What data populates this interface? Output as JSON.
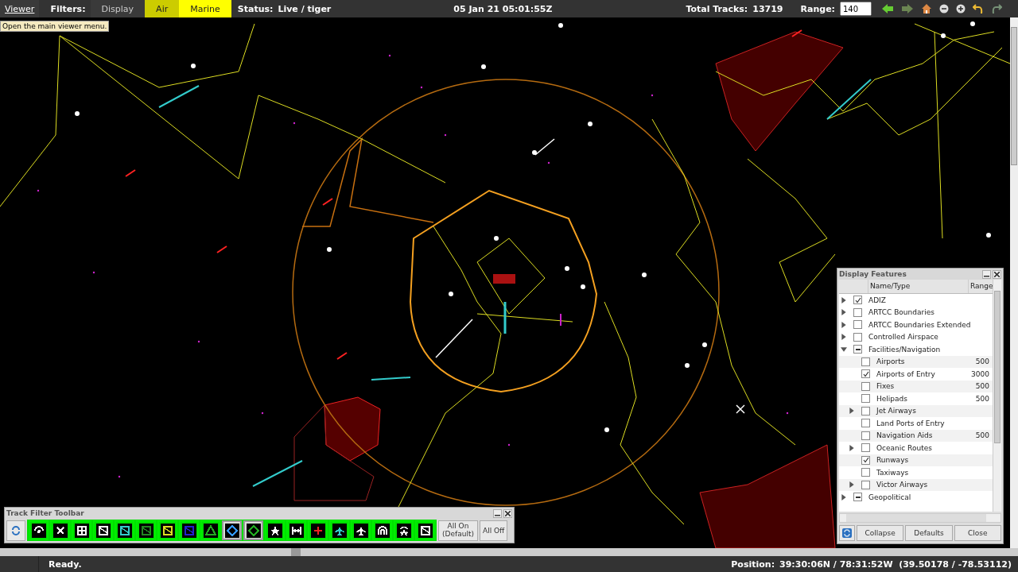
{
  "menu": {
    "label": "Viewer",
    "tooltip": "Open the main viewer menu."
  },
  "filters": {
    "label": "Filters:",
    "buttons": [
      {
        "label": "Display",
        "on": false,
        "pressed": false
      },
      {
        "label": "Air",
        "on": true,
        "pressed": true
      },
      {
        "label": "Marine",
        "on": true,
        "pressed": false
      }
    ]
  },
  "status": {
    "label": "Status:",
    "value": "Live / tiger"
  },
  "time": "05 Jan 21 05:01:55Z",
  "total_tracks": {
    "label": "Total Tracks:",
    "value": "13719"
  },
  "range": {
    "label": "Range:",
    "value": "140"
  },
  "nav_buttons": [
    {
      "kind": "back",
      "disabled": false
    },
    {
      "kind": "forward",
      "disabled": true
    },
    {
      "kind": "home",
      "disabled": false
    },
    {
      "kind": "zoom-out",
      "disabled": false
    },
    {
      "kind": "zoom-in",
      "disabled": false
    },
    {
      "kind": "undo",
      "disabled": false
    },
    {
      "kind": "redo",
      "disabled": true
    }
  ],
  "display_features": {
    "title": "Display Features",
    "columns": [
      "Name/Type",
      "Range"
    ],
    "rows": [
      {
        "label": "ADIZ",
        "checked": true,
        "partial": false,
        "expanded": false
      },
      {
        "label": "ARTCC Boundaries",
        "checked": false,
        "partial": false,
        "expanded": false
      },
      {
        "label": "ARTCC Boundaries Extended",
        "checked": false,
        "partial": false,
        "expanded": false
      },
      {
        "label": "Controlled Airspace",
        "checked": false,
        "partial": false,
        "expanded": false
      },
      {
        "label": "Facilities/Navigation",
        "checked": false,
        "partial": true,
        "expanded": true,
        "children": [
          {
            "label": "Airports",
            "checked": false,
            "partial": false,
            "range": "500"
          },
          {
            "label": "Airports of Entry",
            "checked": true,
            "partial": false,
            "range": "3000"
          },
          {
            "label": "Fixes",
            "checked": false,
            "partial": false,
            "range": "500"
          },
          {
            "label": "Helipads",
            "checked": false,
            "partial": false,
            "range": "500"
          },
          {
            "label": "Jet Airways",
            "checked": false,
            "partial": false,
            "expanded": false
          },
          {
            "label": "Land Ports of Entry",
            "checked": false,
            "partial": false
          },
          {
            "label": "Navigation Aids",
            "checked": false,
            "partial": false,
            "range": "500"
          },
          {
            "label": "Oceanic Routes",
            "checked": false,
            "partial": false,
            "expanded": false
          },
          {
            "label": "Runways",
            "checked": true,
            "partial": false
          },
          {
            "label": "Taxiways",
            "checked": false,
            "partial": false
          },
          {
            "label": "Victor Airways",
            "checked": false,
            "partial": false,
            "expanded": false
          }
        ]
      },
      {
        "label": "Geopolitical",
        "checked": false,
        "partial": true,
        "expanded": false
      }
    ],
    "buttons": [
      "Collapse",
      "Defaults",
      "Close"
    ]
  },
  "track_filter": {
    "title": "Track Filter Toolbar",
    "filters": [
      {
        "kind": "fan",
        "color": "#ffffff",
        "on": true
      },
      {
        "kind": "cross",
        "color": "#ffffff",
        "on": true
      },
      {
        "kind": "grid",
        "color": "#ffffff",
        "on": true
      },
      {
        "kind": "box",
        "color": "#ffffff",
        "on": true
      },
      {
        "kind": "box",
        "color": "#33cccc",
        "on": true
      },
      {
        "kind": "box",
        "color": "#228822",
        "on": true
      },
      {
        "kind": "box",
        "color": "#dddd22",
        "on": true
      },
      {
        "kind": "box",
        "color": "#2222cc",
        "on": true
      },
      {
        "kind": "triangle",
        "color": "#22aa22",
        "on": true
      },
      {
        "kind": "diamond",
        "color": "#3399ff",
        "on": false
      },
      {
        "kind": "diamond",
        "color": "#22aa22",
        "on": false
      },
      {
        "kind": "star",
        "color": "#ffffff",
        "on": true
      },
      {
        "kind": "runway",
        "color": "#ffffff",
        "on": true
      },
      {
        "kind": "plus",
        "color": "#ee2222",
        "on": true
      },
      {
        "kind": "plane",
        "color": "#33cccc",
        "on": true
      },
      {
        "kind": "plane",
        "color": "#ffffff",
        "on": true
      },
      {
        "kind": "arch",
        "color": "#ffffff",
        "on": true
      },
      {
        "kind": "wave",
        "color": "#ffffff",
        "on": true
      },
      {
        "kind": "box",
        "color": "#ffffff",
        "on": true
      }
    ],
    "buttons": [
      "All On (Default)",
      "All Off"
    ]
  },
  "status_bar": {
    "message": "Ready.",
    "position_label": "Position:",
    "position": "39:30:06N / 78:31:52W  (39.50178 / -78.53112)"
  }
}
